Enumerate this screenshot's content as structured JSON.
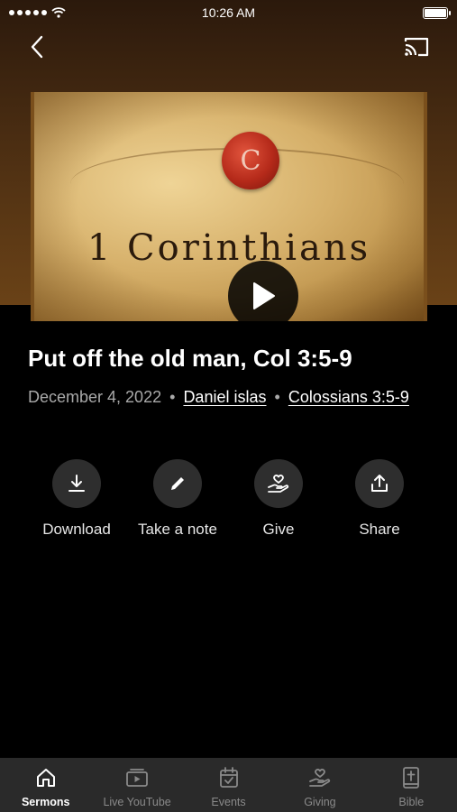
{
  "status_bar": {
    "time": "10:26 AM",
    "battery_level": 1.0
  },
  "nav": {
    "back_icon": "chevron-left-icon",
    "cast_icon": "cast-icon"
  },
  "artwork": {
    "seal_letter": "C",
    "title": "1 Corinthians",
    "play_icon": "play-icon"
  },
  "sermon": {
    "title": "Put off the old man, Col 3:5-9",
    "date": "December 4, 2022",
    "separator": "•",
    "speaker": "Daniel islas",
    "scripture": "Colossians 3:5-9"
  },
  "actions": [
    {
      "label": "Download",
      "icon": "download-icon"
    },
    {
      "label": "Take a note",
      "icon": "pencil-icon"
    },
    {
      "label": "Give",
      "icon": "heart-hand-icon"
    },
    {
      "label": "Share",
      "icon": "share-icon"
    }
  ],
  "tabs": [
    {
      "label": "Sermons",
      "icon": "home-icon",
      "active": true
    },
    {
      "label": "Live YouTube",
      "icon": "video-icon",
      "active": false
    },
    {
      "label": "Events",
      "icon": "calendar-icon",
      "active": false
    },
    {
      "label": "Giving",
      "icon": "heart-hand-icon",
      "active": false
    },
    {
      "label": "Bible",
      "icon": "bible-icon",
      "active": false
    }
  ],
  "colors": {
    "background": "#000000",
    "hero_brown": "#5a3814",
    "action_circle": "#2e2e2e",
    "tab_bar": "#2a2a2a",
    "meta_text": "#a9a9a9"
  }
}
